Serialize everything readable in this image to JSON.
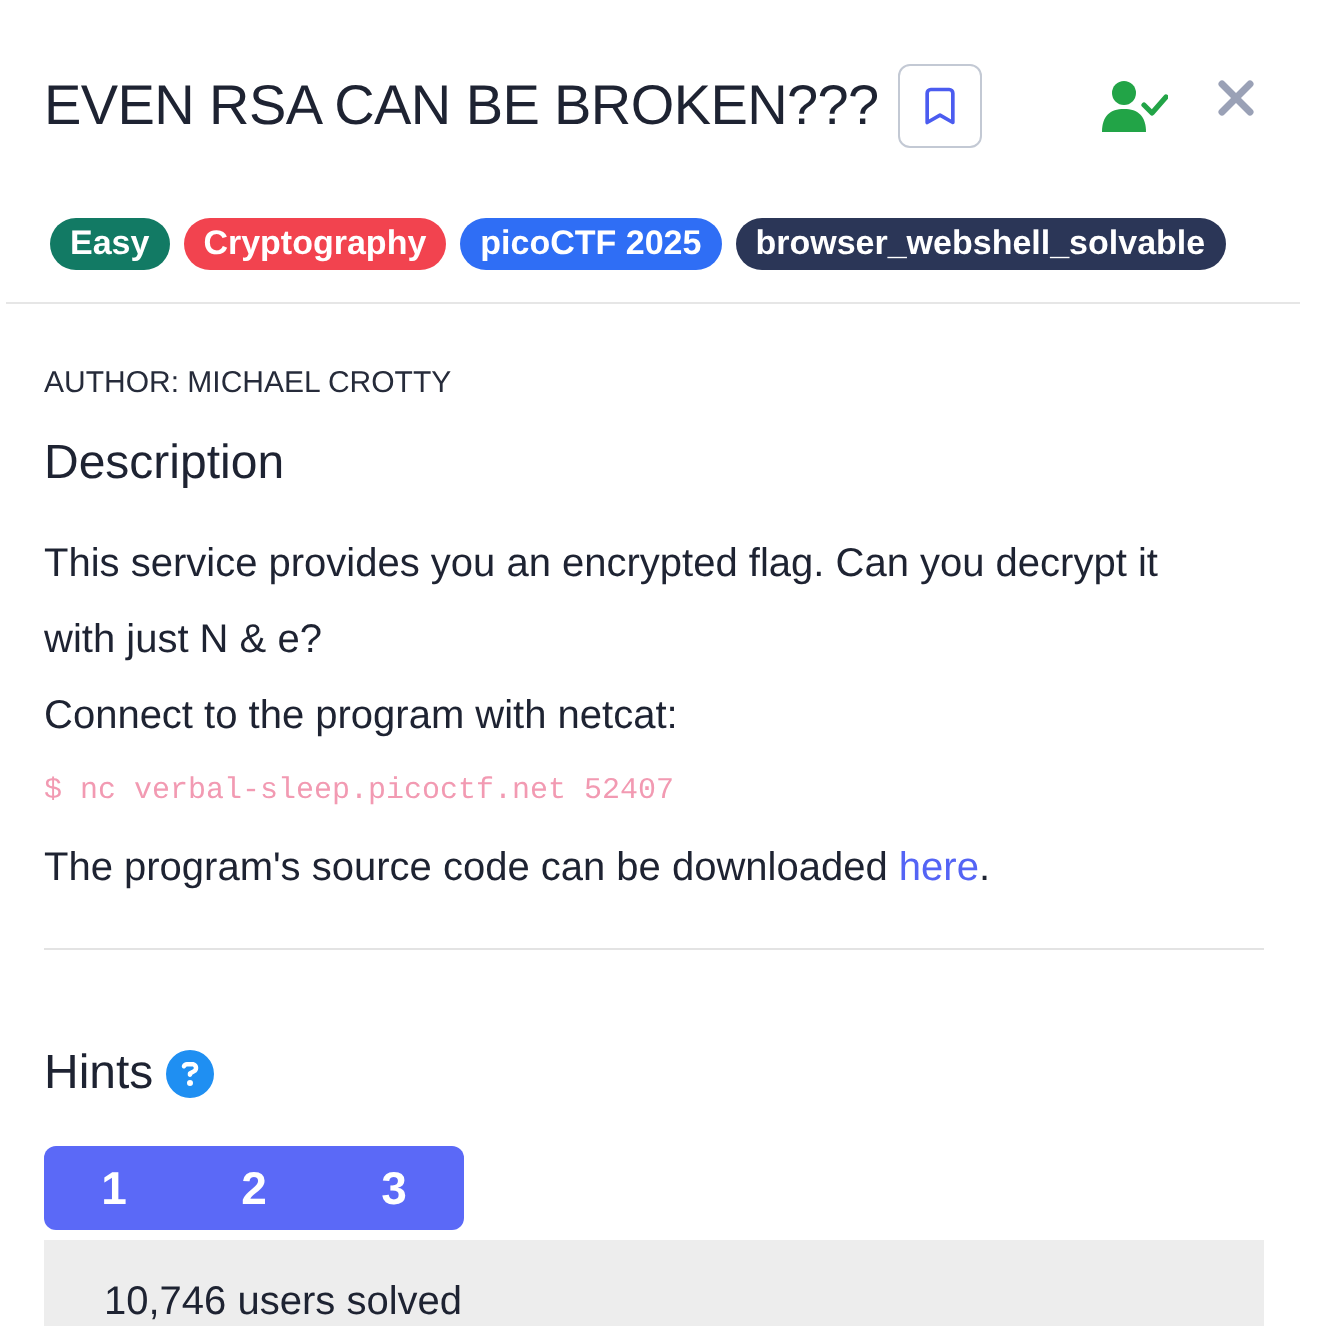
{
  "header": {
    "title": "EVEN RSA CAN BE BROKEN???",
    "bookmarked": false
  },
  "tags": [
    {
      "label": "Easy",
      "color": "#127a64"
    },
    {
      "label": "Cryptography",
      "color": "#f2434f"
    },
    {
      "label": "picoCTF 2025",
      "color": "#2f6ef5"
    },
    {
      "label": "browser_webshell_solvable",
      "color": "#2b3657"
    }
  ],
  "author": "AUTHOR: MICHAEL CROTTY",
  "description": {
    "heading": "Description",
    "paragraph": "This service provides you an encrypted flag. Can you decrypt it with just N & e?",
    "connect_text": "Connect to the program with netcat:",
    "command": "$ nc verbal-sleep.picoctf.net 52407",
    "download_text": {
      "before": "The program's source code can be downloaded ",
      "link": "here",
      "after": "."
    }
  },
  "hints": {
    "heading": "Hints",
    "buttons": [
      "1",
      "2",
      "3"
    ]
  },
  "solved_panel": {
    "text": "10,746 users solved"
  }
}
